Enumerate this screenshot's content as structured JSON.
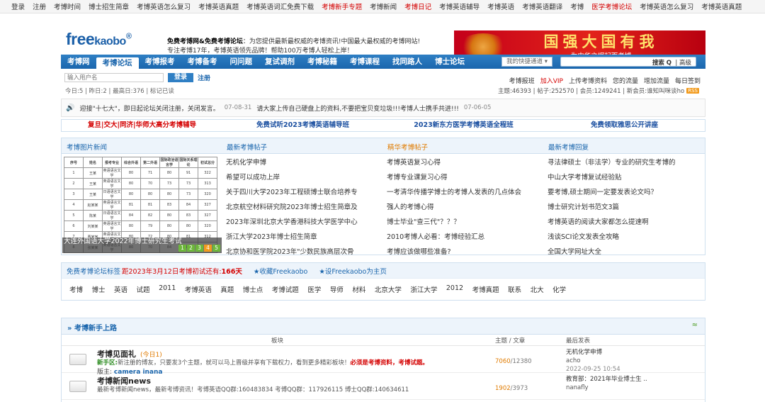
{
  "topbar": [
    "登录",
    "注册",
    "考博时间",
    "博士招生简章",
    "考博英语怎么复习",
    "考博英语真题",
    "考博英语词汇免费下载",
    "考博新手专题",
    "考博新闻",
    "考博日记",
    "考博英语辅导",
    "考博英语",
    "考博英语翻译",
    "考博",
    "医学考博论坛",
    "考博英语怎么复习",
    "考博英语真题"
  ],
  "topbar_red_indices": [
    7,
    9,
    14
  ],
  "header": {
    "logo_a": "free",
    "logo_b": "kaobo",
    "logo_reg": "®",
    "intro_bold": "免费考博网&免费考博论坛",
    "intro_line1": "：为您提供最新最权威的考博资讯!中国最大最权威的考博网站!",
    "intro_line2": "专注考博17年，考博英语领先品牌！帮助100万考博人轻松上岸！",
    "banner_big": "国强大国有我",
    "banner_small": "为中华之崛起而考博"
  },
  "nav": {
    "items": [
      "考博网",
      "考博论坛",
      "考博报考",
      "考博备考",
      "问问题",
      "复试调剂",
      "考博秘籍",
      "考博课程",
      "找同路人",
      "博士论坛"
    ],
    "active_index": 1,
    "shortcut": "我的快捷通道 ▾",
    "search_btn": "搜索 Q",
    "advanced": "| 高级"
  },
  "login": {
    "placeholder": "输入用户名",
    "login_btn": "登录",
    "register": "注册",
    "stats": "今日:5 | 昨日:2 | 最高日:376 | 标记已读"
  },
  "right_links": [
    "考博报班",
    "加入VIP",
    "上传考博资料",
    "您的流量",
    "增加流量",
    "每日签到"
  ],
  "right_links_red_index": 1,
  "right_stats": "主题:46393 | 帖子:252570 | 会员:1249241 | 新会员:谁知叫咪谈ho",
  "rss": "RSS",
  "notice": {
    "text1": "迎接\"十七大\"，即日起论坛关闭注册，关闭发言。",
    "date1": "07-08-31",
    "text2": "请大家上传自己硬盘上的资料,不要把宝贝变垃圾!!!考博人士携手共进!!!",
    "date2": "07-06-05"
  },
  "ads": [
    "复旦|交大|同济|华师大高分考博辅导",
    "免费试听2023考博英语辅导班",
    "2023新东方医学考博英语全程班",
    "免费领取雅思公开讲座"
  ],
  "panel": {
    "head_pic": "考博图片新闻",
    "head_new": "最新考博帖子",
    "head_hot": "精华考博帖子",
    "head_reply": "最新考博回复",
    "thumb_caption": "大连外国语大学2022年博士研究生考试",
    "thumb_pages": [
      "1",
      "2",
      "3",
      "4",
      "5"
    ],
    "thumb_table": [
      [
        "序号",
        "姓名",
        "报考专业",
        "综合外语",
        "第二外语",
        "国际政治语言学",
        "国际关系理论",
        "初试总分"
      ],
      [
        "1",
        "王某",
        "英语语言文学",
        "80",
        "71",
        "80",
        "91",
        "322"
      ],
      [
        "2",
        "王某",
        "英语语言文学",
        "80",
        "70",
        "73",
        "73",
        "313"
      ],
      [
        "3",
        "王某",
        "日语语言文学",
        "80",
        "80",
        "80",
        "73",
        "320"
      ],
      [
        "4",
        "赵某某",
        "英语语言文学",
        "81",
        "81",
        "83",
        "84",
        "327"
      ],
      [
        "5",
        "陈某",
        "日语语言文学",
        "84",
        "82",
        "80",
        "83",
        "327"
      ],
      [
        "6",
        "刘某某",
        "英语语言文学",
        "80",
        "79",
        "80",
        "80",
        "320"
      ],
      [
        "7",
        "曹某某",
        "英语语言文学",
        "80",
        "72",
        "80",
        "81",
        "312"
      ],
      [
        "8",
        "张某某",
        "英语语言文学",
        "80",
        "70",
        "84",
        "82",
        "318"
      ]
    ],
    "new_posts": [
      "无机化学申博",
      "希望可以成功上岸",
      "关于四川大学2023年工程硕博士联合培养专",
      "北京航空材料研究院2023年博士招生简章及",
      "2023年深圳北京大学香港科技大学医学中心",
      "浙江大学2023年博士招生简章",
      "北京协和医学院2023年\"少数民族高层次骨"
    ],
    "hot_posts": [
      "考博英语复习心得",
      "考博专业课复习心得",
      "一考清华传播学博士的考博人发表的几点体会",
      "强人的考博心得",
      "博士毕业\"查三代\"？？？",
      "2010考博人必看：考博经验汇总",
      "考博应该做哪些准备?"
    ],
    "reply_posts": [
      "寻法律硕士（非法学）专业的研究生考博的",
      "中山大学考博复试经验贴",
      "要考博,硕士期间一定要发表论文吗？",
      "博士研究计划书范文3篇",
      "考博英语的阅读大家都怎么提速啊",
      "浅谈SCI论文发表全攻略",
      "全国大学网址大全"
    ]
  },
  "tags": {
    "title": "免费考博论坛标签",
    "countdown_prefix": "距2023年3月12日考博初试还有:",
    "countdown_days": "166天",
    "fav": "★收藏Freekaobo",
    "home": "★设Freekaobo为主页",
    "list": [
      "考博",
      "博士",
      "英语",
      "试题",
      "2011",
      "考博英语",
      "真题",
      "博士点",
      "考博试题",
      "医学",
      "导师",
      "材料",
      "北京大学",
      "浙江大学",
      "2012",
      "考博真题",
      "联系",
      "北大",
      "化学"
    ]
  },
  "forum": {
    "title": "» 考博新手上路",
    "toggle": "≈",
    "col_board": "板块",
    "col_topic": "主题 / 文章",
    "col_last": "最后发表",
    "boards": [
      {
        "name": "考博见面礼",
        "today": "(今日1)",
        "desc_green": "新手区:",
        "desc": "新注册的博友，只要发3个主题，就可以马上晋级并享有下载权力，看到更多精彩板块！",
        "desc_red": "必须是考博资料，考博试题。",
        "mod_label": "版主:",
        "mod": "camera inana",
        "topics": "7060",
        "posts": "/12380",
        "last_title": "无机化学申博",
        "last_author": "acho",
        "last_time": "2022-09-25 10:54"
      },
      {
        "name": "考博新闻news",
        "today": "",
        "desc_green": "",
        "desc": "最新考博新闻news，最新考博资讯！考博英语QQ群:160483834 考博QQ群：117926115 博士QQ群:140634611",
        "desc_red": "",
        "mod_label": "",
        "mod": "",
        "topics": "1902",
        "posts": "/3973",
        "last_title": "教育部：2021年毕业博士生 ..",
        "last_author": "nanafly",
        "last_time": ""
      }
    ]
  }
}
